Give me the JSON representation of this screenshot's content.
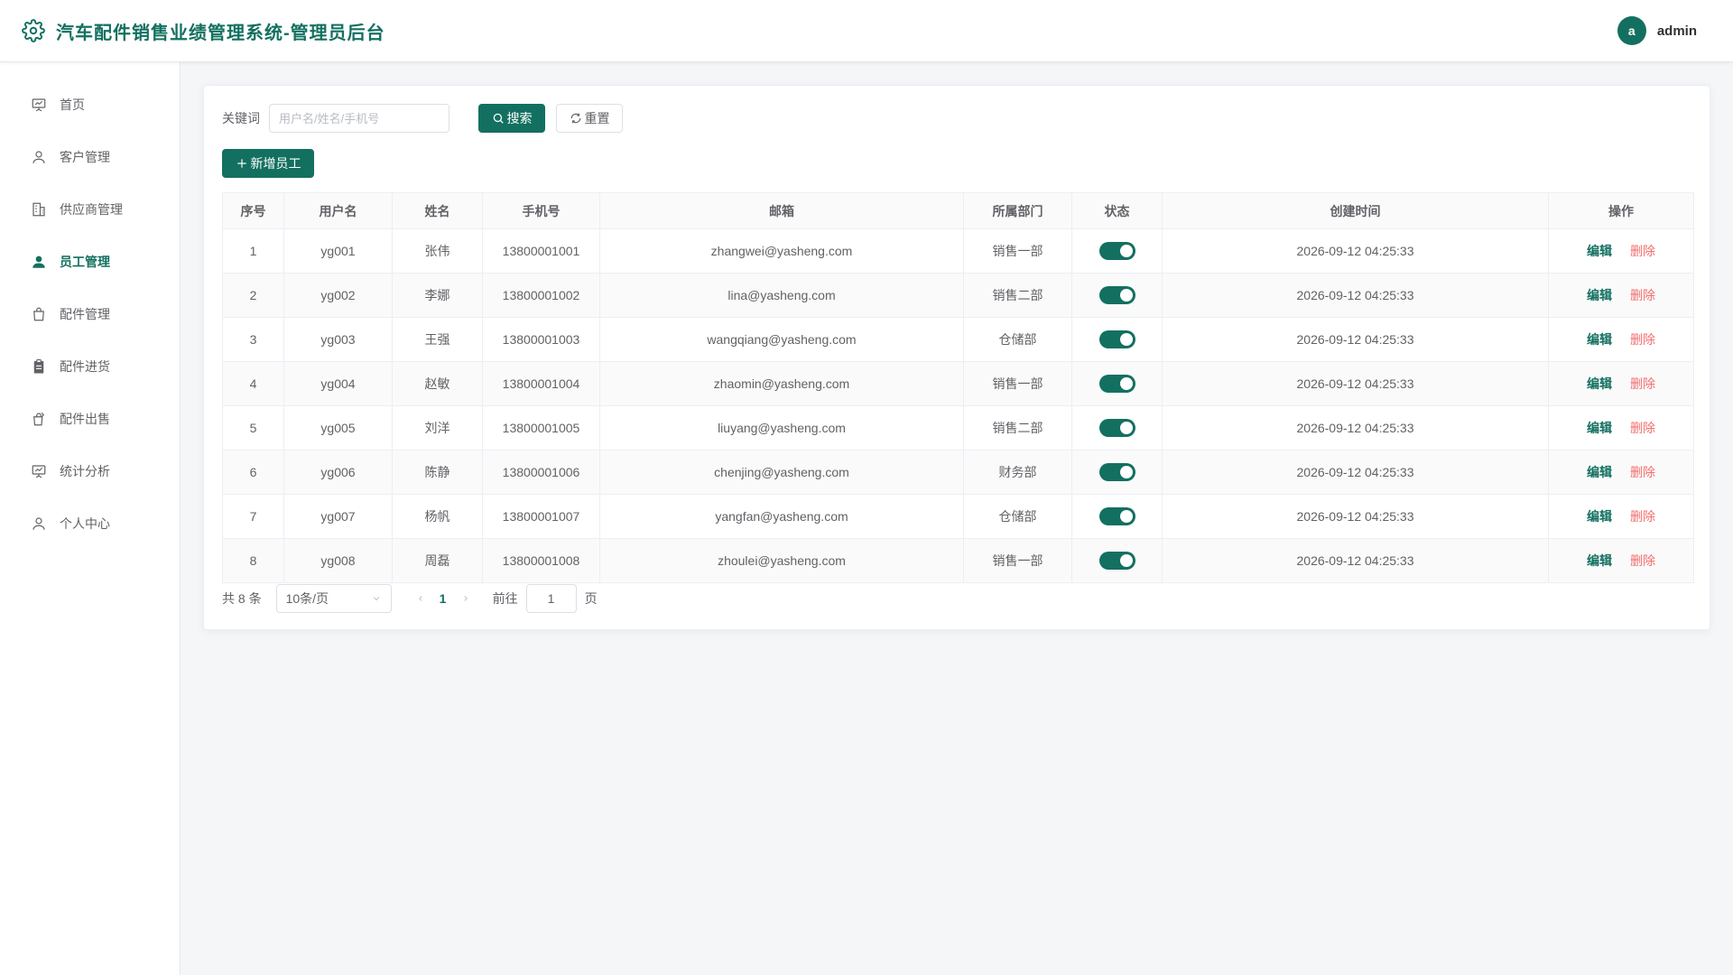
{
  "header": {
    "title": "汽车配件销售业绩管理系统-管理员后台",
    "avatar_letter": "a",
    "username": "admin"
  },
  "sidebar": {
    "items": [
      {
        "label": "首页",
        "icon": "presentation-icon",
        "active": false
      },
      {
        "label": "客户管理",
        "icon": "user-icon",
        "active": false
      },
      {
        "label": "供应商管理",
        "icon": "building-icon",
        "active": false
      },
      {
        "label": "员工管理",
        "icon": "user-filled-icon",
        "active": true
      },
      {
        "label": "配件管理",
        "icon": "shopping-bag-icon",
        "active": false
      },
      {
        "label": "配件进货",
        "icon": "clipboard-icon",
        "active": false
      },
      {
        "label": "配件出售",
        "icon": "sell-icon",
        "active": false
      },
      {
        "label": "统计分析",
        "icon": "presentation-icon",
        "active": false
      },
      {
        "label": "个人中心",
        "icon": "user-icon",
        "active": false
      }
    ]
  },
  "search": {
    "label": "关键词",
    "placeholder": "用户名/姓名/手机号",
    "search_button": "搜索",
    "reset_button": "重置",
    "add_button": "新增员工"
  },
  "table": {
    "headers": [
      "序号",
      "用户名",
      "姓名",
      "手机号",
      "邮箱",
      "所属部门",
      "状态",
      "创建时间",
      "操作"
    ],
    "rows": [
      {
        "no": "1",
        "username": "yg001",
        "name": "张伟",
        "phone": "13800001001",
        "email": "zhangwei@yasheng.com",
        "dept": "销售一部",
        "enabled": true,
        "created": "2026-09-12 04:25:33"
      },
      {
        "no": "2",
        "username": "yg002",
        "name": "李娜",
        "phone": "13800001002",
        "email": "lina@yasheng.com",
        "dept": "销售二部",
        "enabled": true,
        "created": "2026-09-12 04:25:33"
      },
      {
        "no": "3",
        "username": "yg003",
        "name": "王强",
        "phone": "13800001003",
        "email": "wangqiang@yasheng.com",
        "dept": "仓储部",
        "enabled": true,
        "created": "2026-09-12 04:25:33"
      },
      {
        "no": "4",
        "username": "yg004",
        "name": "赵敏",
        "phone": "13800001004",
        "email": "zhaomin@yasheng.com",
        "dept": "销售一部",
        "enabled": true,
        "created": "2026-09-12 04:25:33"
      },
      {
        "no": "5",
        "username": "yg005",
        "name": "刘洋",
        "phone": "13800001005",
        "email": "liuyang@yasheng.com",
        "dept": "销售二部",
        "enabled": true,
        "created": "2026-09-12 04:25:33"
      },
      {
        "no": "6",
        "username": "yg006",
        "name": "陈静",
        "phone": "13800001006",
        "email": "chenjing@yasheng.com",
        "dept": "财务部",
        "enabled": true,
        "created": "2026-09-12 04:25:33"
      },
      {
        "no": "7",
        "username": "yg007",
        "name": "杨帆",
        "phone": "13800001007",
        "email": "yangfan@yasheng.com",
        "dept": "仓储部",
        "enabled": true,
        "created": "2026-09-12 04:25:33"
      },
      {
        "no": "8",
        "username": "yg008",
        "name": "周磊",
        "phone": "13800001008",
        "email": "zhoulei@yasheng.com",
        "dept": "销售一部",
        "enabled": true,
        "created": "2026-09-12 04:25:33"
      }
    ],
    "edit_label": "编辑",
    "delete_label": "删除"
  },
  "pagination": {
    "total_text": "共 8 条",
    "page_size": "10条/页",
    "current_page": "1",
    "goto_label": "前往",
    "goto_value": "1",
    "page_suffix": "页"
  },
  "colors": {
    "primary": "#137060",
    "danger": "#f56c6c"
  }
}
